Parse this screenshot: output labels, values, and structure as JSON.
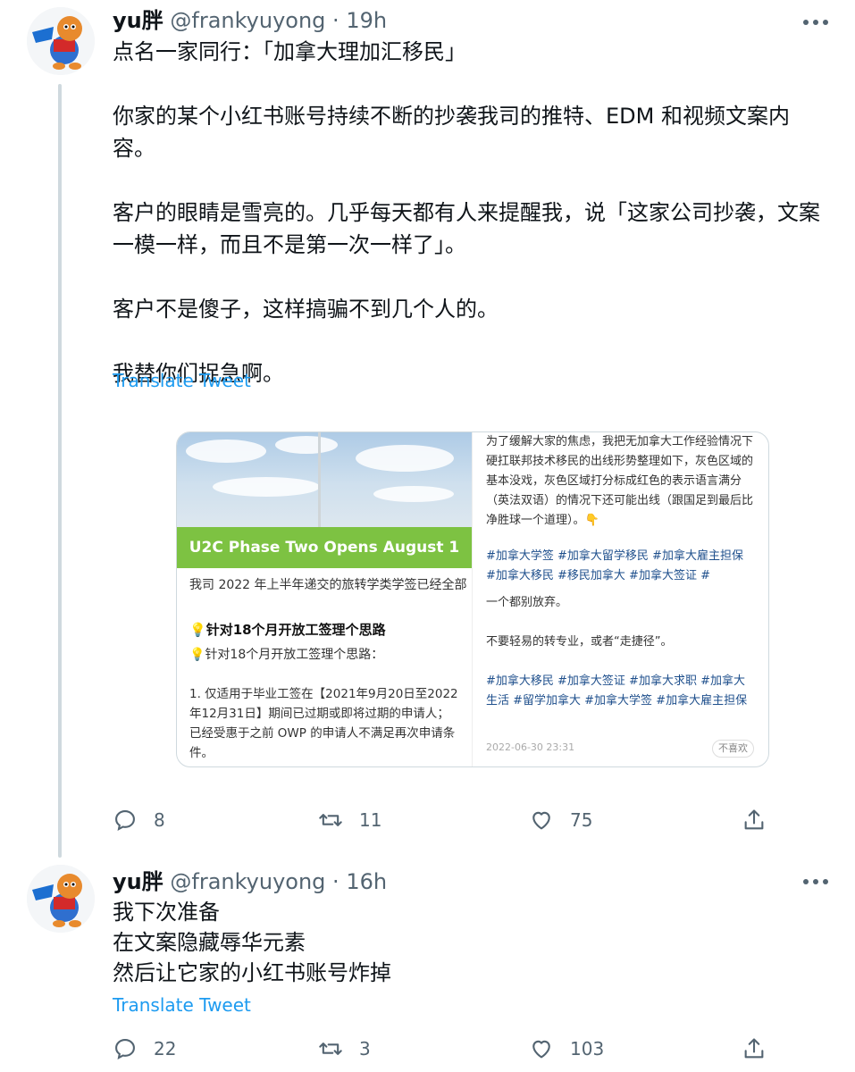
{
  "tweets": [
    {
      "author_name": "yu胖",
      "handle": "@frankyuyong",
      "time": "19h",
      "text": "点名一家同行：「加拿大理加汇移民」\n\n你家的某个小红书账号持续不断的抄袭我司的推特、EDM 和视频文案内容。\n\n客户的眼睛是雪亮的。几乎每天都有人来提醒我，说「这家公司抄袭，文案一模一样，而且不是第一次一样了」。\n\n客户不是傻子，这样搞骗不到几个人的。\n\n我替你们捉急啊。",
      "translate_label": "Translate Tweet",
      "replies": "8",
      "retweets": "11",
      "likes": "75"
    },
    {
      "author_name": "yu胖",
      "handle": "@frankyuyong",
      "time": "16h",
      "text": "我下次准备\n在文案隐藏辱华元素\n然后让它家的小红书账号炸掉",
      "translate_label": "Translate Tweet",
      "replies": "22",
      "retweets": "3",
      "likes": "103"
    }
  ],
  "separator": "·",
  "media": {
    "banner": "U2C Phase Two Opens August 1",
    "left_line1": "我司 2022 年上半年递交的旅转学类学签已经全部",
    "left_heading": "针对18个月开放工签理个思路",
    "left_sub": "针对18个月开放工签理个思路：",
    "left_body": "1. 仅适用于毕业工签在【2021年9月20日至2022\n年12月31日】期间已过期或即将过期的申请人；\n已经受惠于之前 OWP 的申请人不满足再次申请条\n件。",
    "right_para1": "为了缓解大家的焦虑，我把无加拿大工作经验情况下硬扛联邦技术移民的出线形势整理如下，灰色区域的基本没戏，灰色区域打分标成红色的表示语言满分（英法双语）的情况下还可能出线（跟国足到最后比净胜球一个道理）。👇",
    "right_tags1": "#加拿大学签 #加拿大留学移民 #加拿大雇主担保 #加拿大移民 #移民加拿大 #加拿大签证 #",
    "right_cut": "一个都别放弃。",
    "right_para2": "不要轻易的转专业，或者“走捷径”。",
    "right_tags2": "#加拿大移民 #加拿大签证 #加拿大求职 #加拿大生活 #留学加拿大 #加拿大学签 #加拿大雇主担保",
    "right_date": "2022-06-30 23:31",
    "right_dislike": "不喜欢"
  },
  "icons": [
    "avatar",
    "more-icon",
    "reply-icon",
    "retweet-icon",
    "like-icon",
    "share-icon"
  ],
  "colors": {
    "link": "#1d9bf0",
    "muted": "#536471",
    "banner_green": "#7dc242",
    "tag_blue": "#1e4f8c"
  }
}
